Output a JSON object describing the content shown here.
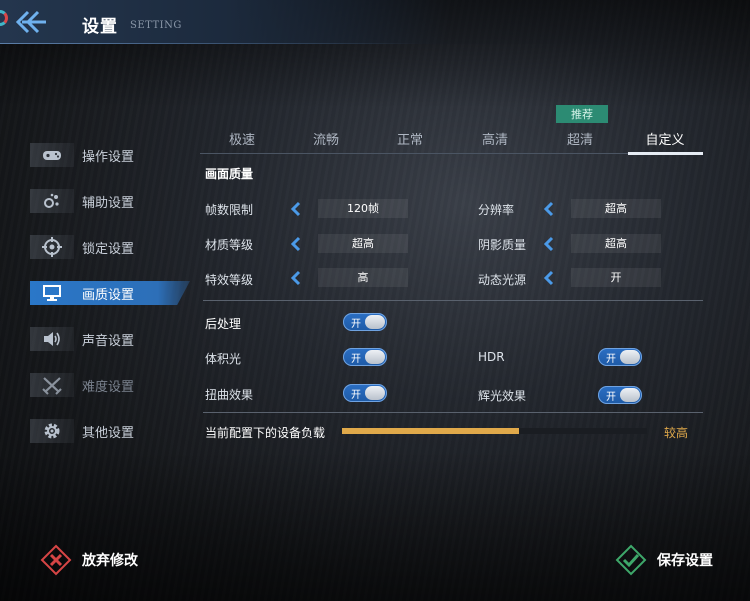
{
  "header": {
    "title": "设置",
    "title_en": "SETTING"
  },
  "sidebar": {
    "items": [
      {
        "label": "操作设置",
        "icon": "gamepad-icon",
        "state": "normal"
      },
      {
        "label": "辅助设置",
        "icon": "dots-cluster-icon",
        "state": "normal"
      },
      {
        "label": "锁定设置",
        "icon": "crosshair-icon",
        "state": "normal"
      },
      {
        "label": "画质设置",
        "icon": "monitor-icon",
        "state": "active"
      },
      {
        "label": "声音设置",
        "icon": "speaker-icon",
        "state": "normal"
      },
      {
        "label": "难度设置",
        "icon": "crossed-swords-icon",
        "state": "disabled"
      },
      {
        "label": "其他设置",
        "icon": "gear-icon",
        "state": "normal"
      }
    ]
  },
  "quality_tabs": {
    "recommend_badge": "推荐",
    "items": [
      "极速",
      "流畅",
      "正常",
      "高清",
      "超清",
      "自定义"
    ],
    "recommended_index": 4,
    "active_index": 5
  },
  "graphics": {
    "section_title": "画面质量",
    "rows": [
      {
        "label": "帧数限制",
        "value": "120帧"
      },
      {
        "label": "分辨率",
        "value": "超高"
      },
      {
        "label": "材质等级",
        "value": "超高"
      },
      {
        "label": "阴影质量",
        "value": "超高"
      },
      {
        "label": "特效等级",
        "value": "高"
      },
      {
        "label": "动态光源",
        "value": "开"
      }
    ]
  },
  "post_processing": {
    "main": {
      "label": "后处理",
      "state": "开"
    },
    "items": [
      {
        "label": "体积光",
        "state": "开"
      },
      {
        "label": "HDR",
        "state": "开"
      },
      {
        "label": "扭曲效果",
        "state": "开"
      },
      {
        "label": "辉光效果",
        "state": "开"
      }
    ]
  },
  "device_load": {
    "label": "当前配置下的设备负载",
    "level": "较高",
    "fraction": 0.58
  },
  "footer": {
    "discard_label": "放弃修改",
    "save_label": "保存设置"
  },
  "colors": {
    "accent_blue": "#2a77c8",
    "recommend_green": "#2c8b73",
    "load_orange": "#e0a94a",
    "discard_red": "#d64545",
    "save_green": "#3ea86a"
  }
}
